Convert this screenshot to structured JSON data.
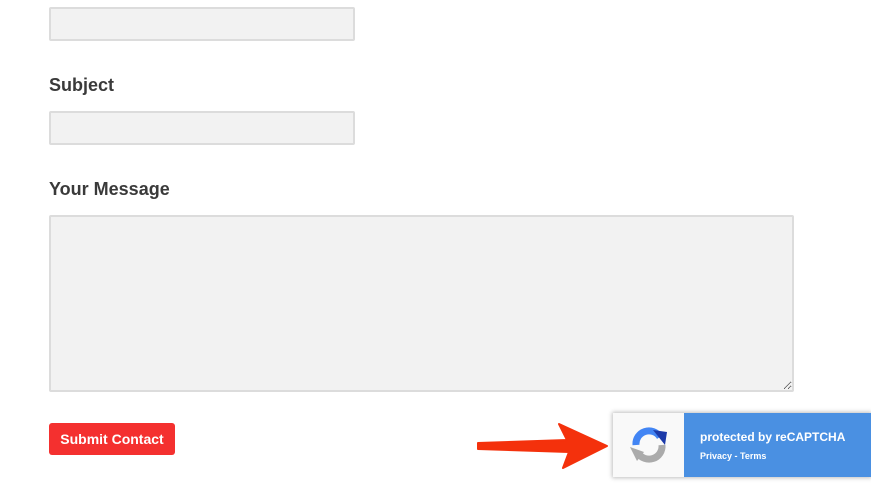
{
  "form": {
    "top_field": {
      "value": "",
      "placeholder": ""
    },
    "subject": {
      "label": "Subject",
      "value": "",
      "placeholder": ""
    },
    "message": {
      "label": "Your Message",
      "value": "",
      "placeholder": ""
    },
    "submit_label": "Submit Contact"
  },
  "recaptcha": {
    "title": "protected by reCAPTCHA",
    "privacy_label": "Privacy",
    "separator": " - ",
    "terms_label": "Terms",
    "colors": {
      "panel": "#4a90e2",
      "logo_dark": "#1c3aa9",
      "logo_blue": "#4285f4",
      "logo_gray": "#ababab"
    }
  },
  "annotation": {
    "arrow_color": "#f4310c"
  },
  "colors": {
    "accent": "#f4302f",
    "field_background": "#f2f2f2",
    "field_border": "#dcdcdc",
    "label_text": "#3a3a3a"
  }
}
